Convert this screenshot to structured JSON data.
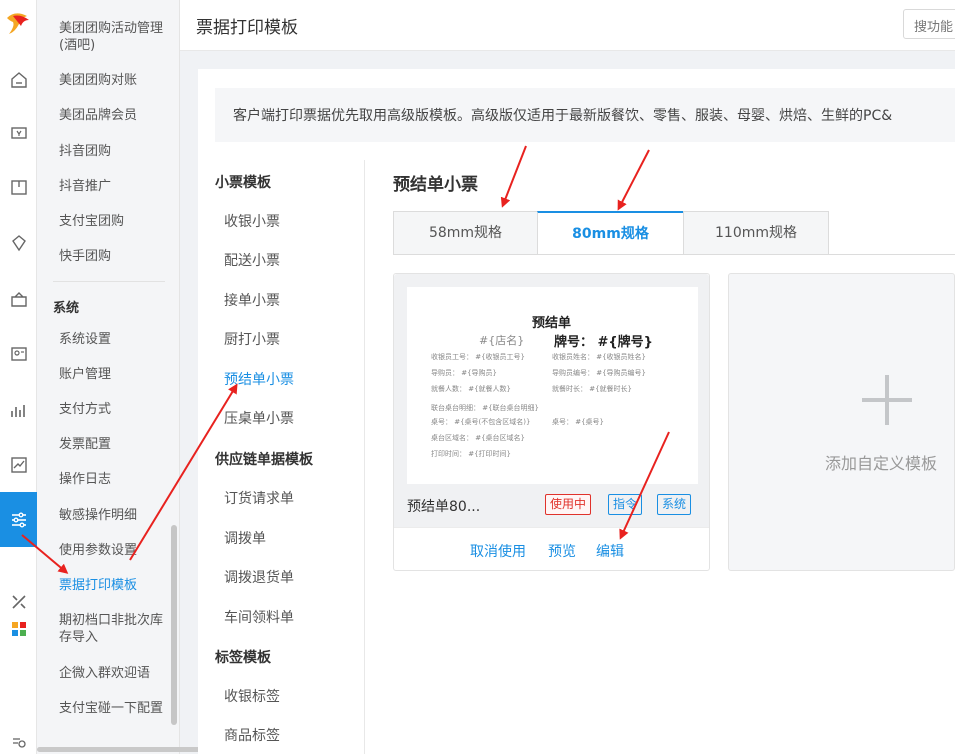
{
  "header": {
    "title": "票据打印模板",
    "search_placeholder": "搜功能"
  },
  "menu": {
    "items": [
      {
        "label": "美团团购活动管理(酒吧)",
        "top": 0
      },
      {
        "label": "美团团购对账"
      },
      {
        "label": "美团品牌会员"
      },
      {
        "label": "抖音团购"
      },
      {
        "label": "抖音推广"
      },
      {
        "label": "支付宝团购"
      },
      {
        "label": "快手团购"
      }
    ],
    "section": "系统",
    "system_items": [
      {
        "label": "系统设置"
      },
      {
        "label": "账户管理"
      },
      {
        "label": "支付方式"
      },
      {
        "label": "发票配置"
      },
      {
        "label": "操作日志"
      },
      {
        "label": "敏感操作明细"
      },
      {
        "label": "使用参数设置"
      },
      {
        "label": "票据打印模板"
      },
      {
        "label": "期初档口非批次库存导入"
      },
      {
        "label": "企微入群欢迎语"
      },
      {
        "label": "支付宝碰一下配置"
      }
    ]
  },
  "notice": "客户端打印票据优先取用高级版模板。高级版仅适用于最新版餐饮、零售、服装、母婴、烘焙、生鲜的PC&",
  "template_list": {
    "cat1": "小票模板",
    "cat1_items": [
      "收银小票",
      "配送小票",
      "接单小票",
      "厨打小票",
      "预结单小票",
      "压桌单小票"
    ],
    "cat2": "供应链单据模板",
    "cat2_items": [
      "订货请求单",
      "调拨单",
      "调拨退货单",
      "车间领料单"
    ],
    "cat3": "标签模板",
    "cat3_items": [
      "收银标签",
      "商品标签"
    ]
  },
  "section_title": "预结单小票",
  "tabs": [
    "58mm规格",
    "80mm规格",
    "110mm规格"
  ],
  "template_card": {
    "name": "预结单80...",
    "badges": [
      "使用中",
      "指令",
      "系统"
    ],
    "actions": [
      "取消使用",
      "预览",
      "编辑"
    ],
    "preview": {
      "title": "预结单",
      "store": "#{店名}",
      "plate": "牌号：  #{牌号}",
      "lines": [
        [
          "收银员工号：  #{收银员工号}",
          "收银员姓名：  #{收银员姓名}"
        ],
        [
          "导购员：  #{导购员}",
          "导购员编号：  #{导购员编号}"
        ],
        [
          "就餐人数：  #{就餐人数}",
          "就餐时长：  #{就餐时长}"
        ],
        [
          "联台桌台明细：  #{联台桌台明细}",
          ""
        ],
        [
          "桌号：  #{桌号(不包含区域名)}",
          "桌号：  #{桌号}"
        ],
        [
          "桌台区域名：  #{桌台区域名}",
          ""
        ],
        [
          "打印时间：  #{打印时间}",
          ""
        ]
      ]
    }
  },
  "add_custom": "添加自定义模板",
  "colors": {
    "accent": "#1a8fe3",
    "red": "#e0322b",
    "arrow": "#e8221f"
  }
}
